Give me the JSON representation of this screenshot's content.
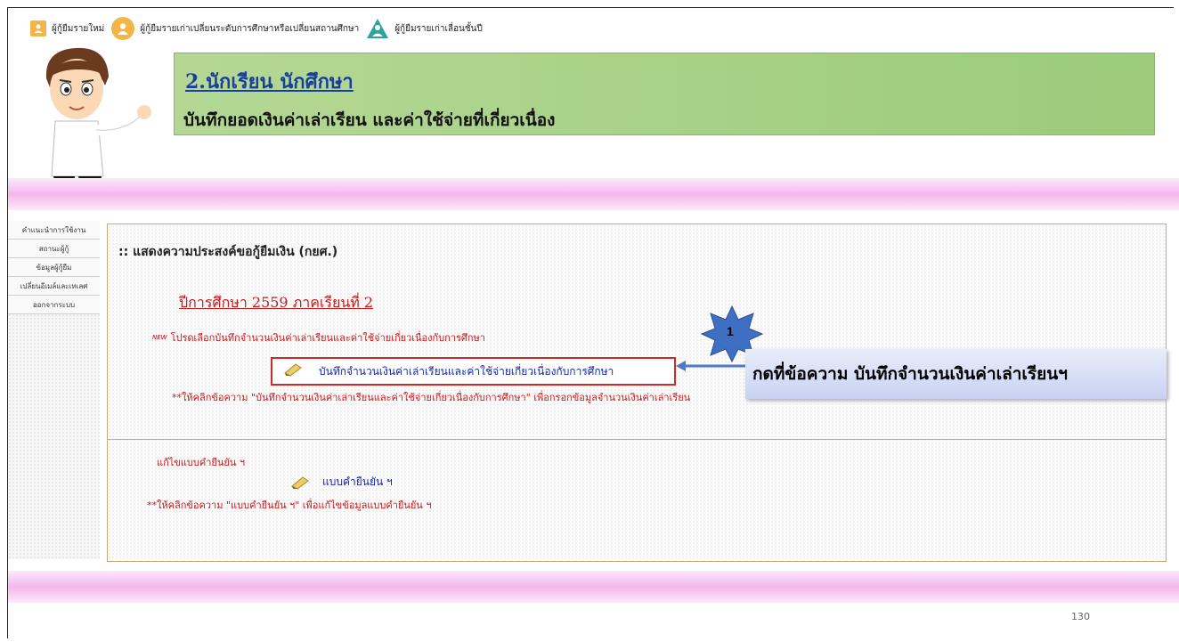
{
  "topnav": {
    "new_borrower": "ผู้กู้ยืมรายใหม่",
    "change_level": "ผู้กู้ยืมรายเก่าเปลี่ยนระดับการศึกษาหรือเปลี่ยนสถานศึกษา",
    "promote_year": "ผู้กู้ยืมรายเก่าเลื่อนชั้นปี"
  },
  "banner": {
    "title": "2.นักเรียน นักศึกษา",
    "subtitle": "บันทึกยอดเงินค่าเล่าเรียน และค่าใช้จ่ายที่เกี่ยวเนื่อง"
  },
  "sidebar": {
    "items": [
      {
        "label": "คำแนะนำการใช้งาน"
      },
      {
        "label": "สถานะผู้กู้"
      },
      {
        "label": "ข้อมูลผู้กู้ยืม"
      },
      {
        "label": "เปลี่ยนอีเมล์และเทเลศ"
      },
      {
        "label": "ออกจากระบบ"
      }
    ]
  },
  "content": {
    "title": ":: แสดงความประสงค์ขอกู้ยืมเงิน (กยศ.)",
    "year_label": "ปีการศึกษา 2559 ภาคเรียนที่ 2",
    "new_badge": "NEW",
    "instruction": "โปรดเลือกบันทึกจำนวนเงินค่าเล่าเรียนและค่าใช้จ่ายเกี่ยวเนื่องกับการศึกษา",
    "record_link": "บันทึกจำนวนเงินค่าเล่าเรียนและค่าใช้จ่ายเกี่ยวเนื่องกับการศึกษา",
    "hint1": "**ให้คลิกข้อความ \"บันทึกจำนวนเงินค่าเล่าเรียนและค่าใช้จ่ายเกี่ยวเนื่องกับการศึกษา\" เพื่อกรอกข้อมูลจำนวนเงินค่าเล่าเรียน",
    "edit_label": "แก้ไขแบบคำยืนยัน ฯ",
    "edit_link": "แบบคำยืนยัน ฯ",
    "hint2": "**ให้คลิกข้อความ \"แบบคำยืนยัน ฯ\" เพื่อแก้ไขข้อมูลแบบคำยืนยัน ฯ"
  },
  "callout": {
    "step": "1",
    "text": "กดที่ข้อความ บันทึกจำนวนเงินค่าเล่าเรียนฯ"
  },
  "page_number": "130",
  "colors": {
    "banner_green": "#a7d186",
    "link_blue": "#1626a8",
    "alert_red": "#d01818",
    "star_blue": "#3f6fc3",
    "pink_band": "#f5b6ee"
  }
}
